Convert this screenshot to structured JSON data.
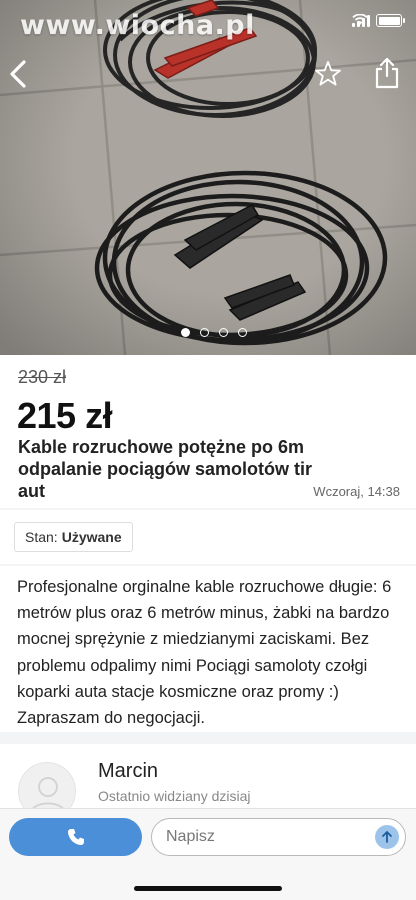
{
  "status_bar": {
    "time": "",
    "watermark": "www.wiocha.pl"
  },
  "gallery": {
    "image_count": 4,
    "active_index": 0
  },
  "icons": {
    "back": "chevron-left-icon",
    "favorite": "star-outline-icon",
    "share": "share-icon",
    "phone": "phone-icon",
    "send": "arrow-up-icon",
    "avatar": "user-silhouette-icon"
  },
  "listing": {
    "old_price": "230 zł",
    "price": "215 zł",
    "title": "Kable rozruchowe potężne po 6m odpalanie pociągów samolotów tir aut",
    "posted": "Wczoraj, 14:38",
    "condition_label": "Stan:",
    "condition_value": "Używane",
    "description": "Profesjonalne orginalne kable rozruchowe długie: 6 metrów plus oraz 6 metrów minus, żabki na bardzo mocnej sprężynie z miedzianymi zaciskami. Bez problemu odpalimy nimi Pociągi samoloty czołgi koparki auta stacje kosmiczne oraz promy :) Zapraszam do negocjacji."
  },
  "seller": {
    "name": "Marcin",
    "last_seen": "Ostatnio widziany dzisiaj"
  },
  "message_bar": {
    "placeholder": "Napisz"
  },
  "colors": {
    "accent": "#4a8fd8",
    "send_button": "#9cc4ea",
    "clamp_red": "#c0392b"
  }
}
